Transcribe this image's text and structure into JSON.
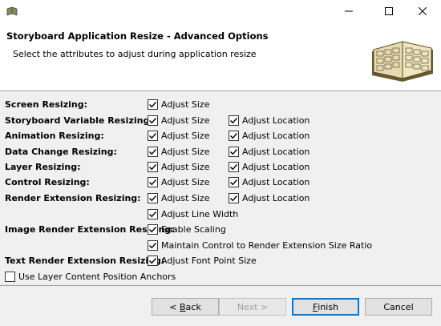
{
  "header": {
    "title": "Storyboard Application Resize - Advanced Options",
    "subtitle": "Select the attributes to adjust during application resize"
  },
  "labels": {
    "adjust_size": "Adjust Size",
    "adjust_location": "Adjust Location"
  },
  "rows": [
    {
      "label": "Screen Resizing:",
      "adjust_size": true
    },
    {
      "label": "Storyboard Variable Resizing:",
      "adjust_size": true,
      "adjust_location": true
    },
    {
      "label": "Animation Resizing:",
      "adjust_size": true,
      "adjust_location": true
    },
    {
      "label": "Data Change Resizing:",
      "adjust_size": true,
      "adjust_location": true
    },
    {
      "label": "Layer Resizing:",
      "adjust_size": true,
      "adjust_location": true
    },
    {
      "label": "Control Resizing:",
      "adjust_size": true,
      "adjust_location": true
    },
    {
      "label": "Render Extension Resizing:",
      "adjust_size": true,
      "adjust_location": true,
      "extra": {
        "label": "Adjust Line Width",
        "checked": true
      }
    },
    {
      "label": "Image Render Extension Resizing:",
      "enable_scaling": {
        "label": "Enable Scaling",
        "checked": true
      },
      "ratio": {
        "label": "Maintain Control to Render Extension Size Ratio",
        "checked": true
      }
    },
    {
      "label": "Text Render Extension Resizing:",
      "font": {
        "label": "Adjust Font Point Size",
        "checked": true
      }
    }
  ],
  "anchors": {
    "label": "Use Layer Content Position Anchors",
    "checked": false
  },
  "buttons": {
    "back": {
      "prefix": "< ",
      "mnemonic": "B",
      "rest": "ack"
    },
    "next": "Next >",
    "finish": {
      "mnemonic": "F",
      "rest": "inish"
    },
    "cancel": "Cancel"
  }
}
